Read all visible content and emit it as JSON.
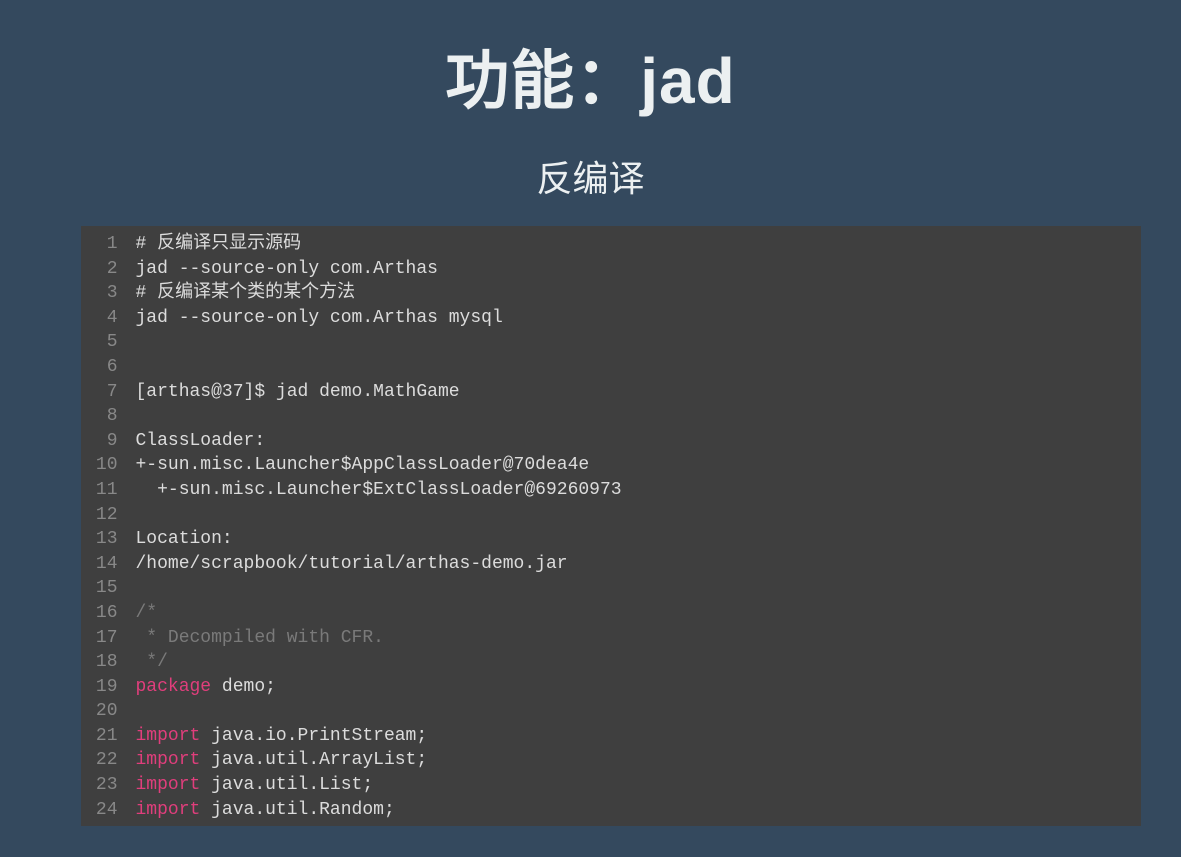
{
  "header": {
    "title": "功能：jad",
    "subtitle": "反编译"
  },
  "code": {
    "lines": [
      {
        "n": 1,
        "tokens": [
          {
            "t": "# 反编译只显示源码",
            "c": "comment-hash"
          }
        ]
      },
      {
        "n": 2,
        "tokens": [
          {
            "t": "jad --source-only com.Arthas",
            "c": "plain"
          }
        ]
      },
      {
        "n": 3,
        "tokens": [
          {
            "t": "# 反编译某个类的某个方法",
            "c": "comment-hash"
          }
        ]
      },
      {
        "n": 4,
        "tokens": [
          {
            "t": "jad --source-only com.Arthas mysql",
            "c": "plain"
          }
        ]
      },
      {
        "n": 5,
        "tokens": [
          {
            "t": "",
            "c": "plain"
          }
        ]
      },
      {
        "n": 6,
        "tokens": [
          {
            "t": "",
            "c": "plain"
          }
        ]
      },
      {
        "n": 7,
        "tokens": [
          {
            "t": "[arthas@37]$ jad demo.MathGame",
            "c": "plain"
          }
        ]
      },
      {
        "n": 8,
        "tokens": [
          {
            "t": "",
            "c": "plain"
          }
        ]
      },
      {
        "n": 9,
        "tokens": [
          {
            "t": "ClassLoader:",
            "c": "plain"
          }
        ]
      },
      {
        "n": 10,
        "tokens": [
          {
            "t": "+-sun.misc.Launcher$AppClassLoader@70dea4e",
            "c": "plain"
          }
        ]
      },
      {
        "n": 11,
        "tokens": [
          {
            "t": "  +-sun.misc.Launcher$ExtClassLoader@69260973",
            "c": "plain"
          }
        ]
      },
      {
        "n": 12,
        "tokens": [
          {
            "t": "",
            "c": "plain"
          }
        ]
      },
      {
        "n": 13,
        "tokens": [
          {
            "t": "Location:",
            "c": "plain"
          }
        ]
      },
      {
        "n": 14,
        "tokens": [
          {
            "t": "/home/scrapbook/tutorial/arthas-demo.jar",
            "c": "plain"
          }
        ]
      },
      {
        "n": 15,
        "tokens": [
          {
            "t": "",
            "c": "plain"
          }
        ]
      },
      {
        "n": 16,
        "tokens": [
          {
            "t": "/*",
            "c": "block-comment"
          }
        ]
      },
      {
        "n": 17,
        "tokens": [
          {
            "t": " * Decompiled with CFR.",
            "c": "block-comment"
          }
        ]
      },
      {
        "n": 18,
        "tokens": [
          {
            "t": " */",
            "c": "block-comment"
          }
        ]
      },
      {
        "n": 19,
        "tokens": [
          {
            "t": "package",
            "c": "keyword"
          },
          {
            "t": " demo;",
            "c": "plain"
          }
        ]
      },
      {
        "n": 20,
        "tokens": [
          {
            "t": "",
            "c": "plain"
          }
        ]
      },
      {
        "n": 21,
        "tokens": [
          {
            "t": "import",
            "c": "keyword"
          },
          {
            "t": " java.io.PrintStream;",
            "c": "plain"
          }
        ]
      },
      {
        "n": 22,
        "tokens": [
          {
            "t": "import",
            "c": "keyword"
          },
          {
            "t": " java.util.ArrayList;",
            "c": "plain"
          }
        ]
      },
      {
        "n": 23,
        "tokens": [
          {
            "t": "import",
            "c": "keyword"
          },
          {
            "t": " java.util.List;",
            "c": "plain"
          }
        ]
      },
      {
        "n": 24,
        "tokens": [
          {
            "t": "import",
            "c": "keyword"
          },
          {
            "t": " java.util.Random;",
            "c": "plain"
          }
        ]
      }
    ]
  }
}
